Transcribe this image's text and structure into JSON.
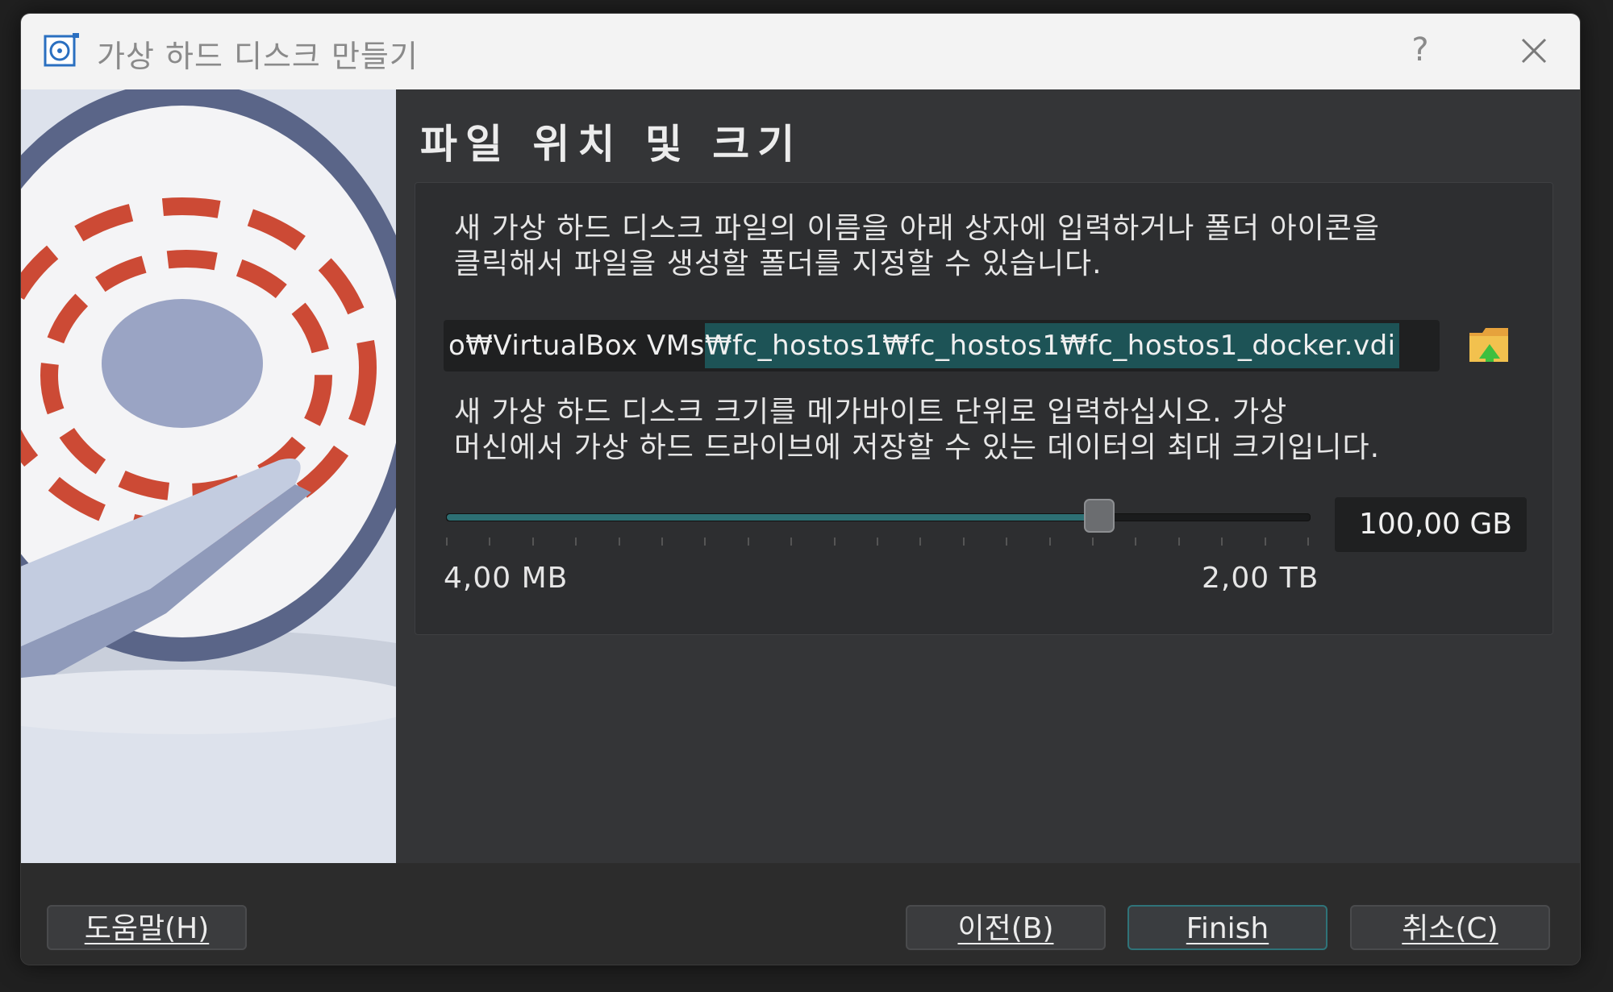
{
  "window": {
    "title": "가상 하드 디스크 만들기",
    "help_glyph": "?"
  },
  "page": {
    "title": "파일 위치 및 크기"
  },
  "location": {
    "description_line1": "새 가상 하드 디스크 파일의 이름을 아래 상자에 입력하거나 폴더 아이콘을",
    "description_line2": "클릭해서 파일을 생성할 폴더를 지정할 수 있습니다.",
    "path_prefix": "o₩VirtualBox VMs",
    "path_selected": "₩fc_hostos1₩fc_hostos1₩fc_hostos1_docker.vdi"
  },
  "size": {
    "description_line1": "새 가상 하드 디스크 크기를 메가바이트 단위로 입력하십시오. 가상",
    "description_line2": "머신에서 가상 하드 드라이브에 저장할 수 있는 데이터의 최대 크기입니다.",
    "value": "100,00 GB",
    "min_label": "4,00 MB",
    "max_label": "2,00 TB",
    "slider_fraction": 0.755,
    "tick_count": 21
  },
  "buttons": {
    "help": "도움말(H)",
    "back": "이전(B)",
    "finish": "Finish",
    "cancel": "취소(C)"
  },
  "colors": {
    "accent": "#2d6f73",
    "selection": "#1d5356"
  }
}
